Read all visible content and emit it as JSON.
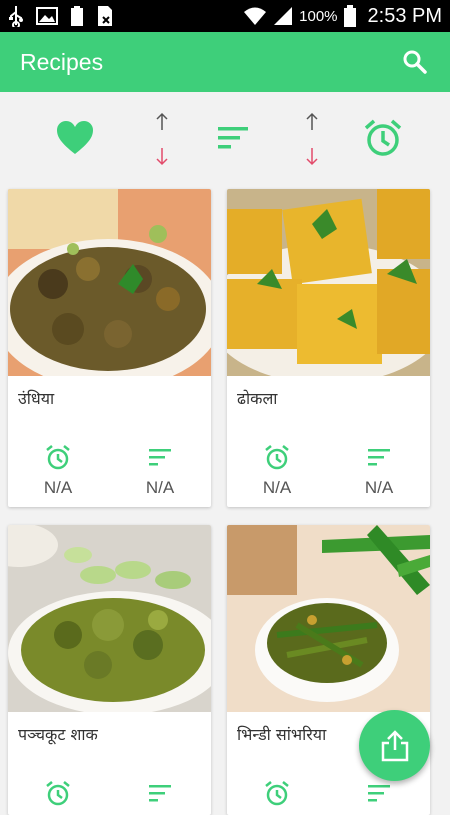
{
  "status_bar": {
    "battery_pct": "100%",
    "time": "2:53 PM"
  },
  "app_bar": {
    "title": "Recipes"
  },
  "colors": {
    "accent": "#3ecf7a",
    "arrow_down": "#e24b6b",
    "arrow_up": "#555555"
  },
  "filters": {
    "favorite": "heart-icon",
    "sort_order_1": "up-down-arrows-icon",
    "sort": "sort-lines-icon",
    "sort_order_2": "up-down-arrows-icon",
    "time": "alarm-clock-icon"
  },
  "recipes": [
    {
      "title": "उंधिया",
      "time": "N/A",
      "servings": "N/A"
    },
    {
      "title": "ढोकला",
      "time": "N/A",
      "servings": "N/A"
    },
    {
      "title": "पञ्चकूट शाक",
      "time": "",
      "servings": ""
    },
    {
      "title": "भिन्डी सांभरिया",
      "time": "",
      "servings": ""
    }
  ],
  "fab": {
    "icon": "share-icon"
  }
}
